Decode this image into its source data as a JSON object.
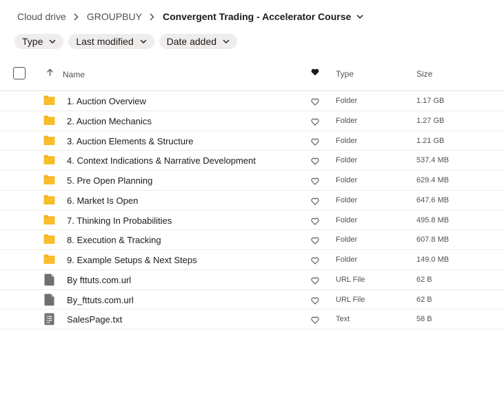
{
  "breadcrumb": {
    "root": "Cloud drive",
    "parent": "GROUPBUY",
    "current": "Convergent Trading - Accelerator Course"
  },
  "filters": [
    {
      "label": "Type"
    },
    {
      "label": "Last modified"
    },
    {
      "label": "Date added"
    }
  ],
  "columns": {
    "name": "Name",
    "type": "Type",
    "size": "Size"
  },
  "files": [
    {
      "name": "1. Auction Overview",
      "type": "Folder",
      "size": "1.17 GB",
      "icon": "folder-icon"
    },
    {
      "name": "2. Auction Mechanics",
      "type": "Folder",
      "size": "1.27 GB",
      "icon": "folder-icon"
    },
    {
      "name": "3. Auction Elements & Structure",
      "type": "Folder",
      "size": "1.21 GB",
      "icon": "folder-icon"
    },
    {
      "name": "4. Context Indications & Narrative Development",
      "type": "Folder",
      "size": "537.4 MB",
      "icon": "folder-icon"
    },
    {
      "name": "5. Pre Open Planning",
      "type": "Folder",
      "size": "629.4 MB",
      "icon": "folder-icon"
    },
    {
      "name": "6. Market Is Open",
      "type": "Folder",
      "size": "647.6 MB",
      "icon": "folder-icon"
    },
    {
      "name": "7. Thinking In Probabilities",
      "type": "Folder",
      "size": "495.8 MB",
      "icon": "folder-icon"
    },
    {
      "name": "8. Execution & Tracking",
      "type": "Folder",
      "size": "607.8 MB",
      "icon": "folder-icon"
    },
    {
      "name": "9. Example Setups & Next Steps",
      "type": "Folder",
      "size": "149.0 MB",
      "icon": "folder-icon"
    },
    {
      "name": "By fttuts.com.url",
      "type": "URL File",
      "size": "62 B",
      "icon": "file-icon"
    },
    {
      "name": "By_fttuts.com.url",
      "type": "URL File",
      "size": "62 B",
      "icon": "file-icon"
    },
    {
      "name": "SalesPage.txt",
      "type": "Text",
      "size": "58 B",
      "icon": "text-file-icon"
    }
  ],
  "colors": {
    "folder": "#f7b31b",
    "file": "#6d6f73",
    "text_primary": "#1e1919",
    "text_secondary": "#52514f",
    "chip_bg": "#efedec"
  }
}
